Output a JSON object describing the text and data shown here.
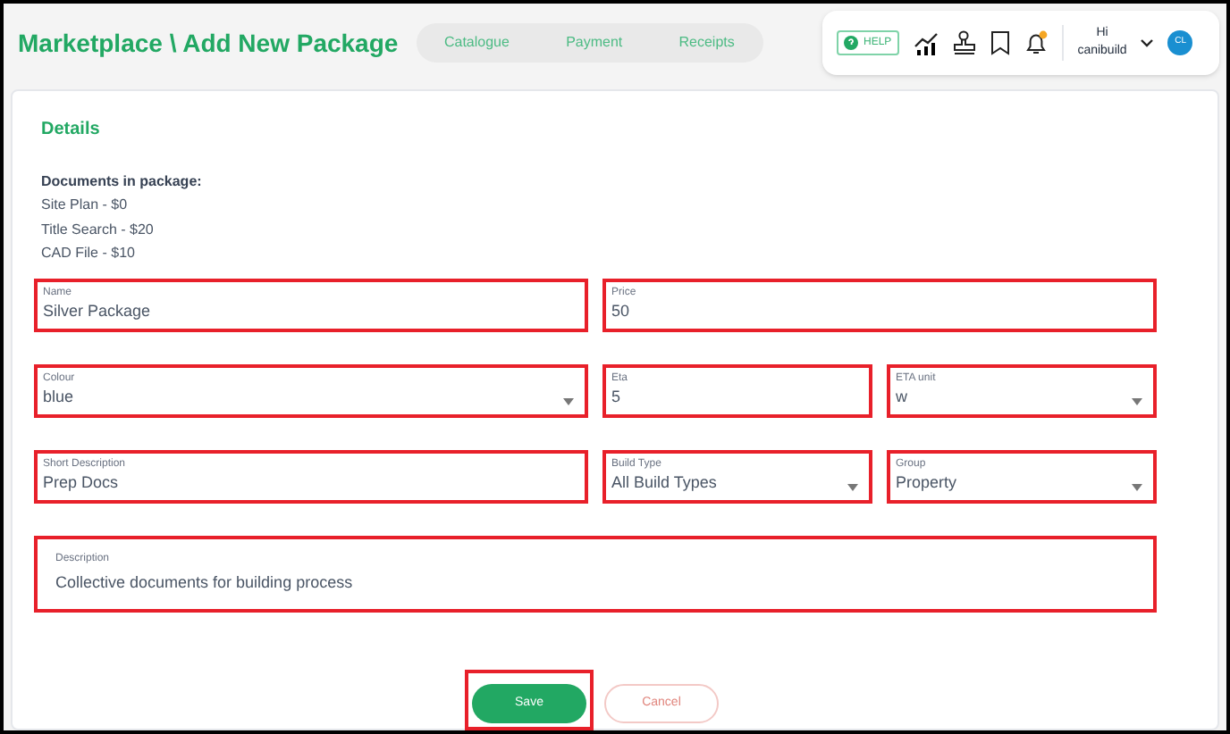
{
  "header": {
    "title": "Marketplace \\ Add New Package",
    "nav": [
      {
        "label": "Catalogue",
        "selected": false
      },
      {
        "label": "Payment",
        "selected": false
      },
      {
        "label": "Receipts",
        "selected": false
      }
    ],
    "help": "HELP",
    "notifications_unread": true,
    "greeting": "Hi",
    "username": "canibuild",
    "avatar": "CL"
  },
  "details": {
    "heading": "Details",
    "documents_heading": "Documents in package:",
    "documents": [
      "Site Plan - $0",
      "Title Search - $20",
      "CAD File - $10"
    ],
    "rows": [
      [
        {
          "label": "Name",
          "value": "Silver Package",
          "kind": "text",
          "highlighted": true
        },
        {
          "label": "Price",
          "value": "50",
          "kind": "text",
          "highlighted": true
        }
      ],
      [
        {
          "label": "Colour",
          "value": "blue",
          "kind": "select",
          "highlighted": true
        },
        {
          "label": "Eta",
          "value": "5",
          "kind": "text",
          "highlighted": true
        },
        {
          "label": "ETA unit",
          "value": "w",
          "kind": "select",
          "highlighted": true
        }
      ],
      [
        {
          "label": "Short Description",
          "value": "Prep Docs",
          "kind": "text",
          "highlighted": true
        },
        {
          "label": "Build Type",
          "value": "All Build Types",
          "kind": "select",
          "highlighted": true
        },
        {
          "label": "Group",
          "value": "Property",
          "kind": "select",
          "highlighted": true
        }
      ],
      [
        {
          "label": "Description",
          "value": "Collective documents for building process",
          "kind": "textarea",
          "highlighted": true
        }
      ]
    ]
  },
  "buttons": [
    {
      "label": "Save",
      "kind": "primary",
      "highlighted": true
    },
    {
      "label": "Cancel",
      "kind": "secondary",
      "highlighted": false
    }
  ]
}
